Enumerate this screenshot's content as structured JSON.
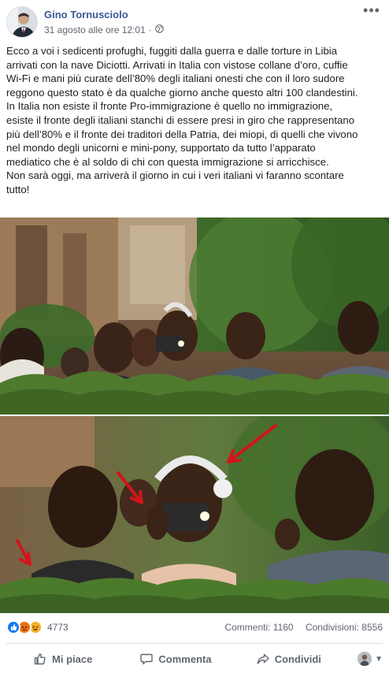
{
  "post": {
    "author": "Gino Tornusciolo",
    "timestamp": "31 agosto alle ore 12:01",
    "privacy_sep": "·",
    "more_label": "•••",
    "text_lines": [
      "Ecco a voi i sedicenti profughi, fuggiti dalla guerra e dalle torture in Libia",
      "arrivati con la nave Diciotti. Arrivati in Italia con vistose collane d’oro, cuffie",
      "Wi-Fi e mani più curate dell’80% degli italiani onesti che con il loro sudore",
      "reggono questo stato è da qualche giorno anche questo altri 100 clandestini.",
      "In Italia non esiste il fronte Pro-immigrazione è quello no immigrazione,",
      "esiste il fronte degli italiani stanchi di essere presi in giro che rappresentano",
      "più dell’80% e il fronte dei traditori della Patria, dei miopi, di quelli che vivono",
      "nel mondo degli unicorni e mini-pony, supportato da tutto l’apparato",
      "mediatico che è al soldo di chi con questa immigrazione si arricchisce.",
      "Non sarà oggi, ma arriverà il giorno in cui i veri italiani vi faranno scontare",
      "tutto!"
    ]
  },
  "stats": {
    "reaction_count": "4773",
    "comments": "Commenti: 1160",
    "shares": "Condivisioni: 8556"
  },
  "actions": {
    "like": "Mi piace",
    "comment": "Commenta",
    "share": "Condividi"
  },
  "colors": {
    "author": "#385898",
    "like_reaction": "#1877f2",
    "angry_reaction": "#e9710f",
    "haha_reaction": "#f7b125",
    "annotation_arrow": "#d0161b"
  }
}
